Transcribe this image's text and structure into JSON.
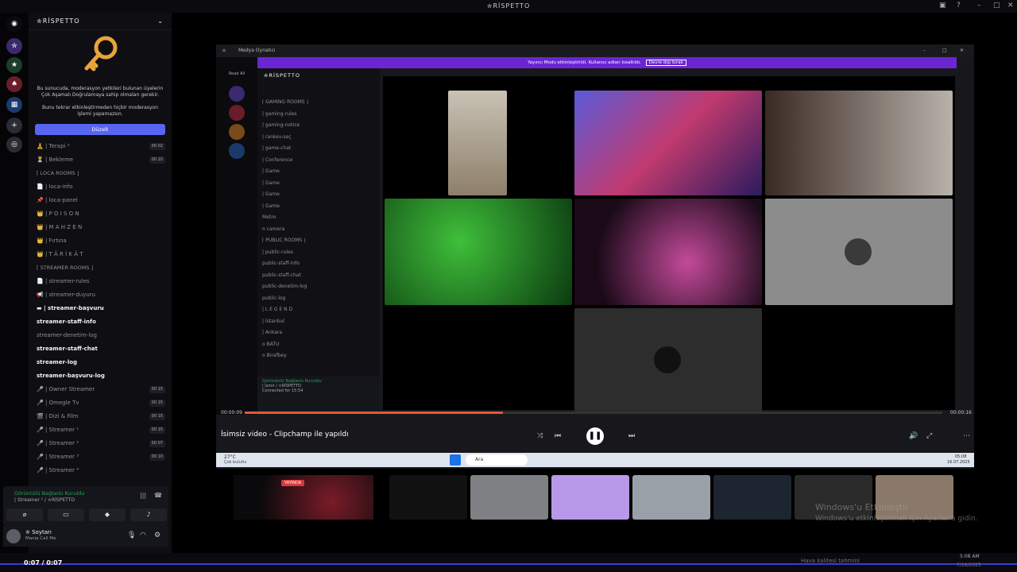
{
  "window": {
    "title": "✮RİSPETTO"
  },
  "server": {
    "name": "✮RİSPETTO"
  },
  "promo": {
    "line1": "Bu sunucuda, moderasyon yetkileri bulunan üyelerin Çok Aşamalı Doğrulamaya sahip olmaları gerekir.",
    "line2": "Bunu tekrar etkinleştirmeden hiçbir moderasyon işlemi yapamazsın.",
    "button": "Düzelt"
  },
  "channels": [
    {
      "label": "🧘 | Terapi ²",
      "count": "00 02",
      "style": "v"
    },
    {
      "label": "⏳ | Bekleme",
      "count": "00 10",
      "style": "v"
    },
    {
      "label": "⌈ LOCA ROOMS ⌋",
      "style": "cat"
    },
    {
      "label": "📄 | loca-info",
      "style": "t"
    },
    {
      "label": "📌 | loca-panel",
      "style": "t"
    },
    {
      "label": "👑 | P O I S O N",
      "style": "l"
    },
    {
      "label": "👑 | M A H Z E N",
      "style": "l"
    },
    {
      "label": "👑 | Fırtına",
      "style": "l"
    },
    {
      "label": "👑 | T Â R İ K Â T",
      "style": "l"
    },
    {
      "label": "⌈ STREAMER ROOMS ⌋",
      "style": "cat"
    },
    {
      "label": "📄 | streamer-rules",
      "style": "t"
    },
    {
      "label": "📢 | streamer-duyuru",
      "style": "t"
    },
    {
      "label": "▬ | streamer-başvuru",
      "style": "b"
    },
    {
      "label": "streamer-staff-info",
      "style": "b"
    },
    {
      "label": "streamer-denetim-log",
      "style": "t"
    },
    {
      "label": "streamer-staff-chat",
      "style": "b"
    },
    {
      "label": "streamer-log",
      "style": "b"
    },
    {
      "label": "streamer-başvuru-log",
      "style": "b"
    },
    {
      "label": "🎤 | Owner Streamer",
      "count": "00 15",
      "style": "v"
    },
    {
      "label": "🎤 | Omegle Tv",
      "count": "00 15",
      "style": "v"
    },
    {
      "label": "🎬 | Dizi & Film",
      "count": "00 15",
      "style": "v"
    },
    {
      "label": "🎤 | Streamer ¹",
      "count": "00 15",
      "style": "v"
    },
    {
      "label": "🎤 | Streamer ²",
      "count": "00 07",
      "style": "v"
    },
    {
      "label": "🎤 | Streamer ³",
      "count": "00 10",
      "style": "v"
    },
    {
      "label": "🎤 | Streamer ⁴",
      "style": "v"
    }
  ],
  "voice": {
    "status": "Görüntülü Bağlantı Kuruldu",
    "channel": "| Streamer ¹ / ✮RİSPETTO"
  },
  "user": {
    "name": "✮ Soytarı",
    "status": "Mania Call Me"
  },
  "inner": {
    "title": "Medya Oynatıcı",
    "banner": "Yayıncı Modu etkinleştirildi. Kullanıcı adları kısaltıldı.",
    "banner_btn": "Devre dışı bırak",
    "server": "✮RİSPETTO",
    "readall": "Read All",
    "channels": [
      "⌈ GAMING ROOMS ⌋",
      "| gaming-rules",
      "| gaming-notice",
      "| rankev-seç",
      "| game-chat",
      "| Conference",
      "| Game",
      "| Game",
      "| Game",
      "| Game",
      "Metro",
      "n camera",
      "⌈ PUBLIC ROOMS ⌋",
      "| public-rules",
      "public-staff-info",
      "public-staff-chat",
      "public-denetim-log",
      "public-log",
      "| L E G E N D",
      "| İstanbul",
      "| Ankara",
      "o BATU",
      "o Birafbey"
    ],
    "voice_status": "Görüntülü Bağlantı Kuruldu",
    "voice_ch": "| İzmir / ✮RİSPETTO",
    "connected": "Connected for 15:54"
  },
  "player": {
    "time_start": "00:00:09",
    "time_end": "00:00:16",
    "video_title": "İsimsiz video - Clipchamp ile yapıldı",
    "progress": 0.37
  },
  "taskbar": {
    "weather": "27°C",
    "weather_desc": "Çok bulutlu",
    "search": "Ara",
    "time": "05:08",
    "date": "16.07.2025"
  },
  "stream": {
    "live": "YAYINDA"
  },
  "watermark": {
    "l1": "Windows'u Etkinleştir",
    "l2": "Windows'u etkinleştirmek için Ayarlar'a gidin."
  },
  "bottom": {
    "time": "0:07 / 0:07",
    "weather": "Hava kalitesi tahmini",
    "clock": "5:08 AM",
    "date": "7/16/2025"
  }
}
